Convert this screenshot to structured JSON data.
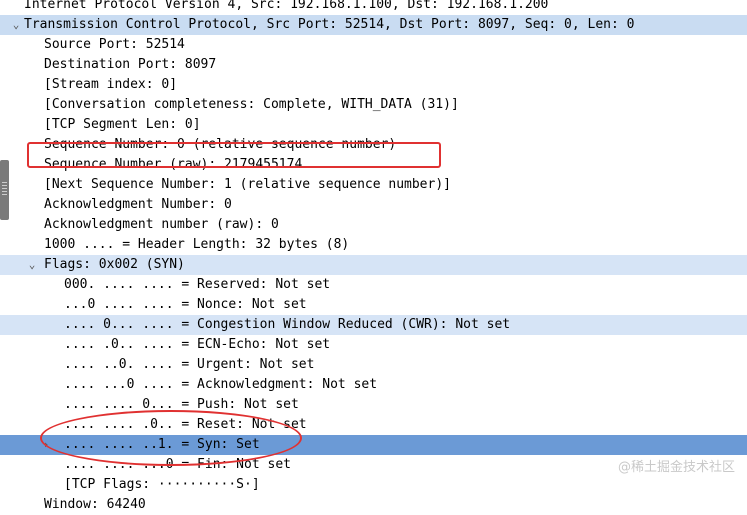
{
  "rows": [
    {
      "text": "Internet Protocol Version 4, Src: 192.168.1.100, Dst: 192.168.1.200",
      "indent": 0,
      "style": "none",
      "expander": ""
    },
    {
      "text": "Transmission Control Protocol, Src Port: 52514, Dst Port: 8097, Seq: 0, Len: 0",
      "indent": 0,
      "style": "header",
      "expander": "⌄"
    },
    {
      "text": "Source Port: 52514",
      "indent": 1,
      "style": "none",
      "expander": ""
    },
    {
      "text": "Destination Port: 8097",
      "indent": 1,
      "style": "none",
      "expander": ""
    },
    {
      "text": "[Stream index: 0]",
      "indent": 1,
      "style": "none",
      "expander": ""
    },
    {
      "text": "[Conversation completeness: Complete, WITH_DATA (31)]",
      "indent": 1,
      "style": "none",
      "expander": ""
    },
    {
      "text": "[TCP Segment Len: 0]",
      "indent": 1,
      "style": "none",
      "expander": ""
    },
    {
      "text": "Sequence Number: 0    (relative sequence number)",
      "indent": 1,
      "style": "none",
      "expander": ""
    },
    {
      "text": "Sequence Number (raw): 2179455174",
      "indent": 1,
      "style": "none",
      "expander": ""
    },
    {
      "text": "[Next Sequence Number: 1    (relative sequence number)]",
      "indent": 1,
      "style": "none",
      "expander": ""
    },
    {
      "text": "Acknowledgment Number: 0",
      "indent": 1,
      "style": "none",
      "expander": ""
    },
    {
      "text": "Acknowledgment number (raw): 0",
      "indent": 1,
      "style": "none",
      "expander": ""
    },
    {
      "text": "1000 .... = Header Length: 32 bytes (8)",
      "indent": 1,
      "style": "none",
      "expander": ""
    },
    {
      "text": "Flags: 0x002 (SYN)",
      "indent": 1,
      "style": "light",
      "expander": "⌄"
    },
    {
      "text": "000. .... .... = Reserved: Not set",
      "indent": 2,
      "style": "none",
      "expander": ""
    },
    {
      "text": "...0 .... .... = Nonce: Not set",
      "indent": 2,
      "style": "none",
      "expander": ""
    },
    {
      "text": ".... 0... .... = Congestion Window Reduced (CWR): Not set",
      "indent": 2,
      "style": "light",
      "expander": ""
    },
    {
      "text": ".... .0.. .... = ECN-Echo: Not set",
      "indent": 2,
      "style": "none",
      "expander": ""
    },
    {
      "text": ".... ..0. .... = Urgent: Not set",
      "indent": 2,
      "style": "none",
      "expander": ""
    },
    {
      "text": ".... ...0 .... = Acknowledgment: Not set",
      "indent": 2,
      "style": "none",
      "expander": ""
    },
    {
      "text": ".... .... 0... = Push: Not set",
      "indent": 2,
      "style": "none",
      "expander": ""
    },
    {
      "text": ".... .... .0.. = Reset: Not set",
      "indent": 2,
      "style": "none",
      "expander": ""
    },
    {
      "text": ".... .... ..1. = Syn: Set",
      "indent": 2,
      "style": "dark",
      "expander": "›"
    },
    {
      "text": ".... .... ...0 = Fin: Not set",
      "indent": 2,
      "style": "none",
      "expander": ""
    },
    {
      "text": "[TCP Flags: ··········S·]",
      "indent": 2,
      "style": "none",
      "expander": ""
    },
    {
      "text": "Window: 64240",
      "indent": 1,
      "style": "none",
      "expander": ""
    }
  ],
  "watermark": "@稀土掘金技术社区",
  "colors": {
    "header_highlight": "#c9dcf2",
    "light_highlight": "#d6e4f6",
    "selected_highlight": "#6b9ad6",
    "annotation_red": "#e03131"
  }
}
